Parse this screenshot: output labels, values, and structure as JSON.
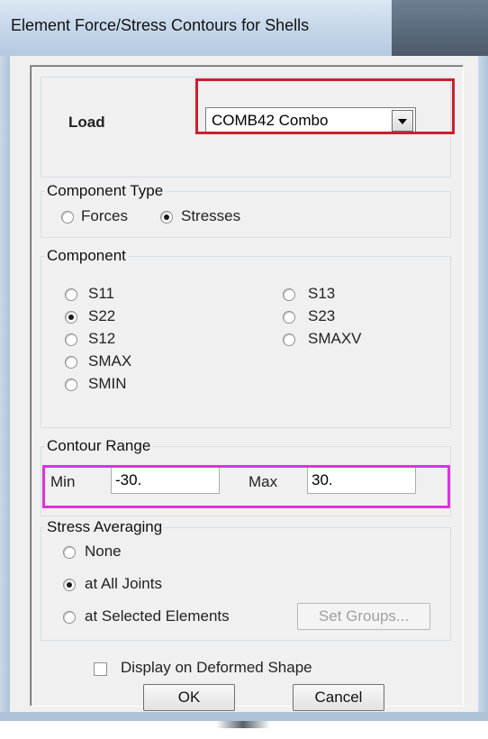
{
  "window": {
    "title": "Element Force/Stress Contours for Shells"
  },
  "load": {
    "label": "Load",
    "selected": "COMB42 Combo"
  },
  "component_type": {
    "legend": "Component Type",
    "options": [
      {
        "label": "Forces",
        "checked": false
      },
      {
        "label": "Stresses",
        "checked": true
      }
    ]
  },
  "component": {
    "legend": "Component",
    "options": [
      {
        "label": "S11",
        "checked": false
      },
      {
        "label": "S22",
        "checked": true
      },
      {
        "label": "S12",
        "checked": false
      },
      {
        "label": "SMAX",
        "checked": false
      },
      {
        "label": "SMIN",
        "checked": false
      },
      {
        "label": "S13",
        "checked": false
      },
      {
        "label": "S23",
        "checked": false
      },
      {
        "label": "SMAXV",
        "checked": false
      }
    ]
  },
  "contour_range": {
    "legend": "Contour Range",
    "min_label": "Min",
    "min_value": "-30.",
    "max_label": "Max",
    "max_value": "30."
  },
  "stress_averaging": {
    "legend": "Stress Averaging",
    "options": [
      {
        "label": "None",
        "checked": false
      },
      {
        "label": "at All Joints",
        "checked": true
      },
      {
        "label": "at Selected Elements",
        "checked": false
      }
    ],
    "set_groups_label": "Set Groups..."
  },
  "display_deformed": {
    "label": "Display on Deformed Shape",
    "checked": false
  },
  "buttons": {
    "ok": "OK",
    "cancel": "Cancel"
  },
  "colors": {
    "highlight_red": "#cc1f2f",
    "highlight_magenta": "#dd33dd"
  }
}
